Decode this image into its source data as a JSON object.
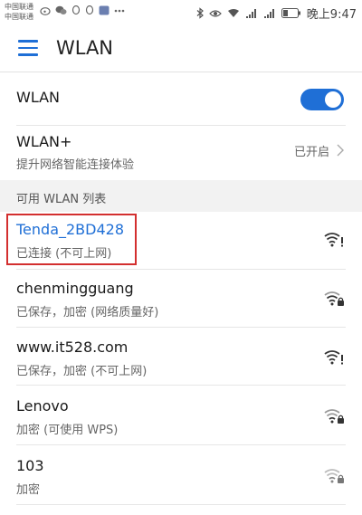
{
  "status_bar": {
    "carrier_1": "中国联通",
    "carrier_2": "中国联通",
    "time": "晚上9:47"
  },
  "app_bar": {
    "title": "WLAN"
  },
  "wlan_toggle": {
    "label": "WLAN",
    "on": true
  },
  "wlan_plus": {
    "label": "WLAN+",
    "subtitle": "提升网络智能连接体验",
    "state": "已开启"
  },
  "section": {
    "header": "可用 WLAN 列表"
  },
  "networks": [
    {
      "name": "Tenda_2BD428",
      "status": "已连接 (不可上网)",
      "connected": true,
      "icon": "wifi-warning-icon"
    },
    {
      "name": "chenmingguang",
      "status": "已保存，加密 (网络质量好)",
      "icon": "wifi-lock-icon"
    },
    {
      "name": "www.it528.com",
      "status": "已保存，加密 (不可上网)",
      "icon": "wifi-warning-icon"
    },
    {
      "name": "Lenovo",
      "status": "加密 (可使用 WPS)",
      "icon": "wifi-lock-icon"
    },
    {
      "name": "103",
      "status": "加密",
      "icon": "wifi-lock-icon"
    }
  ],
  "colors": {
    "accent": "#1f6fd6",
    "highlight": "#d32f2f"
  }
}
